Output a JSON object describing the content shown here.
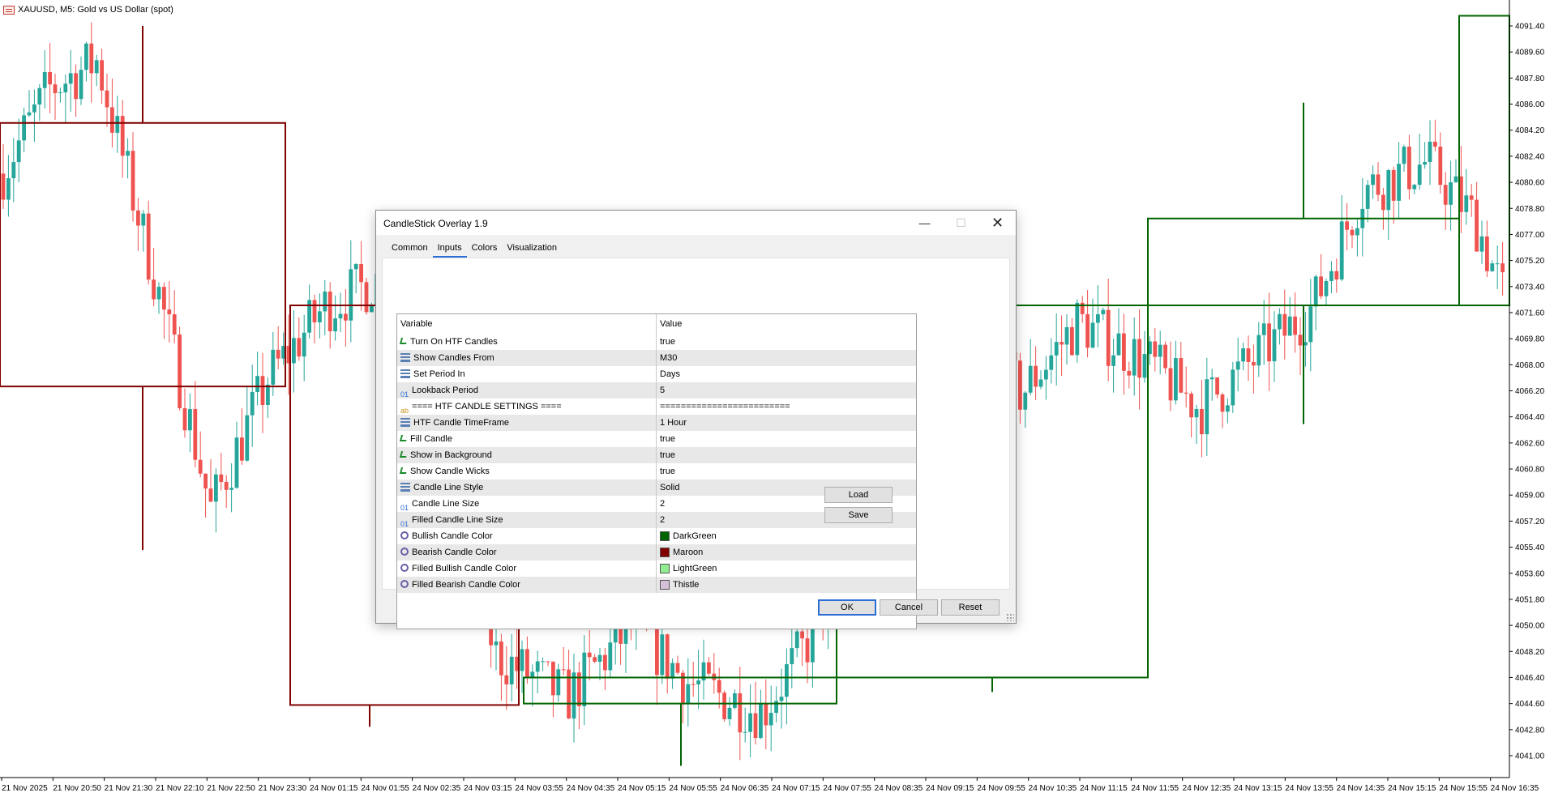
{
  "chart": {
    "symbol_title": "XAUUSD, M5:  Gold vs US Dollar (spot)",
    "price_labels": [
      "4091.40",
      "4089.60",
      "4087.80",
      "4086.00",
      "4084.20",
      "4082.40",
      "4080.60",
      "4078.80",
      "4077.00",
      "4075.20",
      "4073.40",
      "4071.60",
      "4069.80",
      "4068.00",
      "4066.20",
      "4064.40",
      "4062.60",
      "4060.80",
      "4059.00",
      "4057.20",
      "4055.40",
      "4053.60",
      "4051.80",
      "4050.00",
      "4048.20",
      "4046.40",
      "4044.60",
      "4042.80",
      "4041.00"
    ],
    "time_labels": [
      "21 Nov 2025",
      "21 Nov 20:50",
      "21 Nov 21:30",
      "21 Nov 22:10",
      "21 Nov 22:50",
      "21 Nov 23:30",
      "24 Nov 01:15",
      "24 Nov 01:55",
      "24 Nov 02:35",
      "24 Nov 03:15",
      "24 Nov 03:55",
      "24 Nov 04:35",
      "24 Nov 05:15",
      "24 Nov 05:55",
      "24 Nov 06:35",
      "24 Nov 07:15",
      "24 Nov 07:55",
      "24 Nov 08:35",
      "24 Nov 09:15",
      "24 Nov 09:55",
      "24 Nov 10:35",
      "24 Nov 11:15",
      "24 Nov 11:55",
      "24 Nov 12:35",
      "24 Nov 13:15",
      "24 Nov 13:55",
      "24 Nov 14:35",
      "24 Nov 15:15",
      "24 Nov 15:55",
      "24 Nov 16:35"
    ],
    "colors": {
      "bull": "#26a69a",
      "bear": "#ef5350",
      "htf_bull": "#006400",
      "htf_bear": "#800000"
    }
  },
  "dialog": {
    "title": "CandleStick Overlay 1.9",
    "tabs": [
      "Common",
      "Inputs",
      "Colors",
      "Visualization"
    ],
    "active_tab": "Inputs",
    "header": {
      "variable": "Variable",
      "value": "Value"
    },
    "rows": [
      {
        "type": "bool",
        "variable": "Turn On HTF Candles",
        "value": "true"
      },
      {
        "type": "enum",
        "variable": "Show Candles From",
        "value": "M30"
      },
      {
        "type": "enum",
        "variable": "Set Period In",
        "value": "Days"
      },
      {
        "type": "num",
        "variable": "Lookback Period",
        "value": "5"
      },
      {
        "type": "str",
        "variable": "==== HTF CANDLE SETTINGS ====",
        "value": "========================="
      },
      {
        "type": "enum",
        "variable": "HTF Candle TimeFrame",
        "value": "1 Hour"
      },
      {
        "type": "bool",
        "variable": "Fill Candle",
        "value": "true"
      },
      {
        "type": "bool",
        "variable": "Show in Background",
        "value": "true"
      },
      {
        "type": "bool",
        "variable": "Show Candle Wicks",
        "value": "true"
      },
      {
        "type": "enum",
        "variable": "Candle Line Style",
        "value": "Solid"
      },
      {
        "type": "num",
        "variable": "Candle Line Size",
        "value": "2"
      },
      {
        "type": "num",
        "variable": "Filled Candle Line Size",
        "value": "2"
      },
      {
        "type": "color",
        "variable": "Bullish Candle Color",
        "value": "DarkGreen",
        "swatch": "#006400"
      },
      {
        "type": "color",
        "variable": "Bearish Candle Color",
        "value": "Maroon",
        "swatch": "#800000"
      },
      {
        "type": "color",
        "variable": "Filled Bullish Candle Color",
        "value": "LightGreen",
        "swatch": "#90ee90"
      },
      {
        "type": "color",
        "variable": "Filled Bearish Candle Color",
        "value": "Thistle",
        "swatch": "#d8bfd8"
      }
    ],
    "buttons": {
      "load": "Load",
      "save": "Save",
      "ok": "OK",
      "cancel": "Cancel",
      "reset": "Reset"
    },
    "icon_glyphs": {
      "num": "01",
      "str": "ab"
    }
  }
}
